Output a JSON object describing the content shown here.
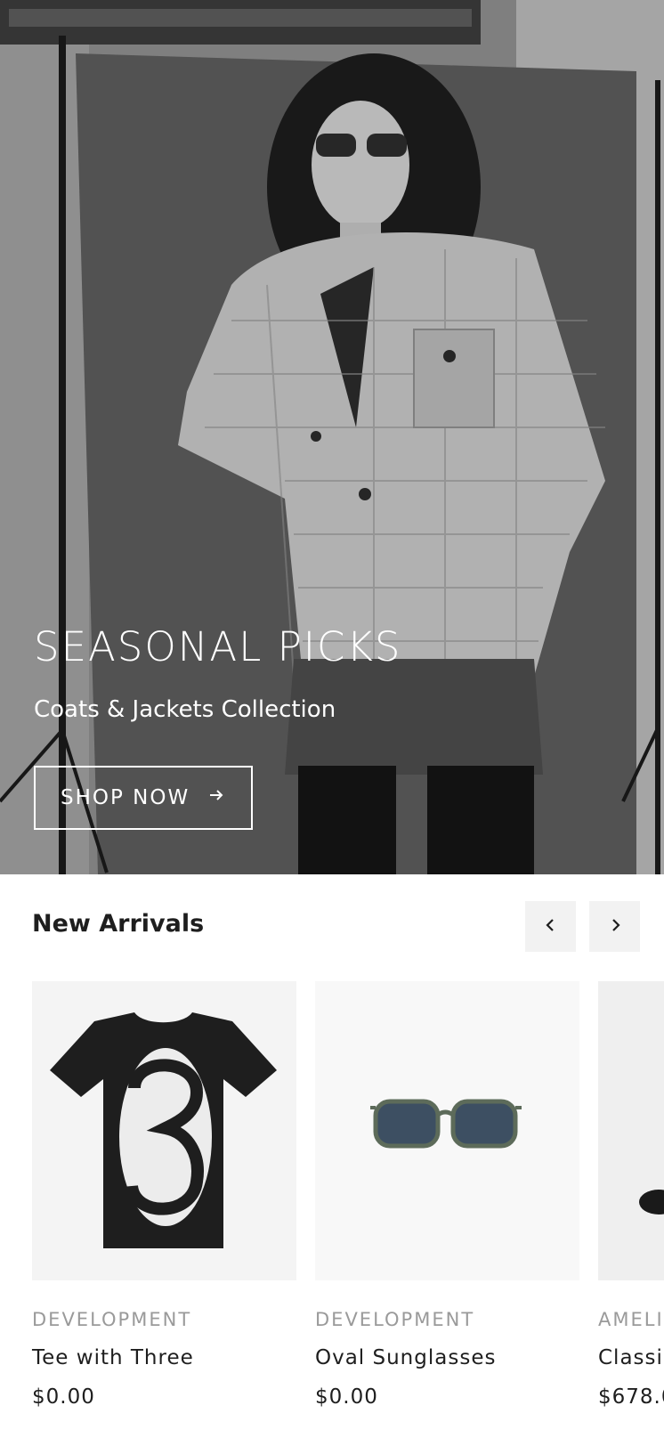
{
  "hero": {
    "title": "SEASONAL PICKS",
    "subtitle": "Coats & Jackets Collection",
    "cta_label": "SHOP NOW"
  },
  "new_arrivals": {
    "title": "New Arrivals",
    "prev_icon": "chevron-left-icon",
    "next_icon": "chevron-right-icon",
    "products": [
      {
        "brand": "DEVELOPMENT",
        "name": "Tee with Three",
        "price": "$0.00"
      },
      {
        "brand": "DEVELOPMENT",
        "name": "Oval Sunglasses",
        "price": "$0.00"
      },
      {
        "brand": "AMELI",
        "name": "Classi",
        "price": "$678.0"
      }
    ]
  },
  "colors": {
    "text": "#1e1e1e",
    "muted": "#9a9a9a",
    "nav_bg": "#f2f2f2"
  }
}
